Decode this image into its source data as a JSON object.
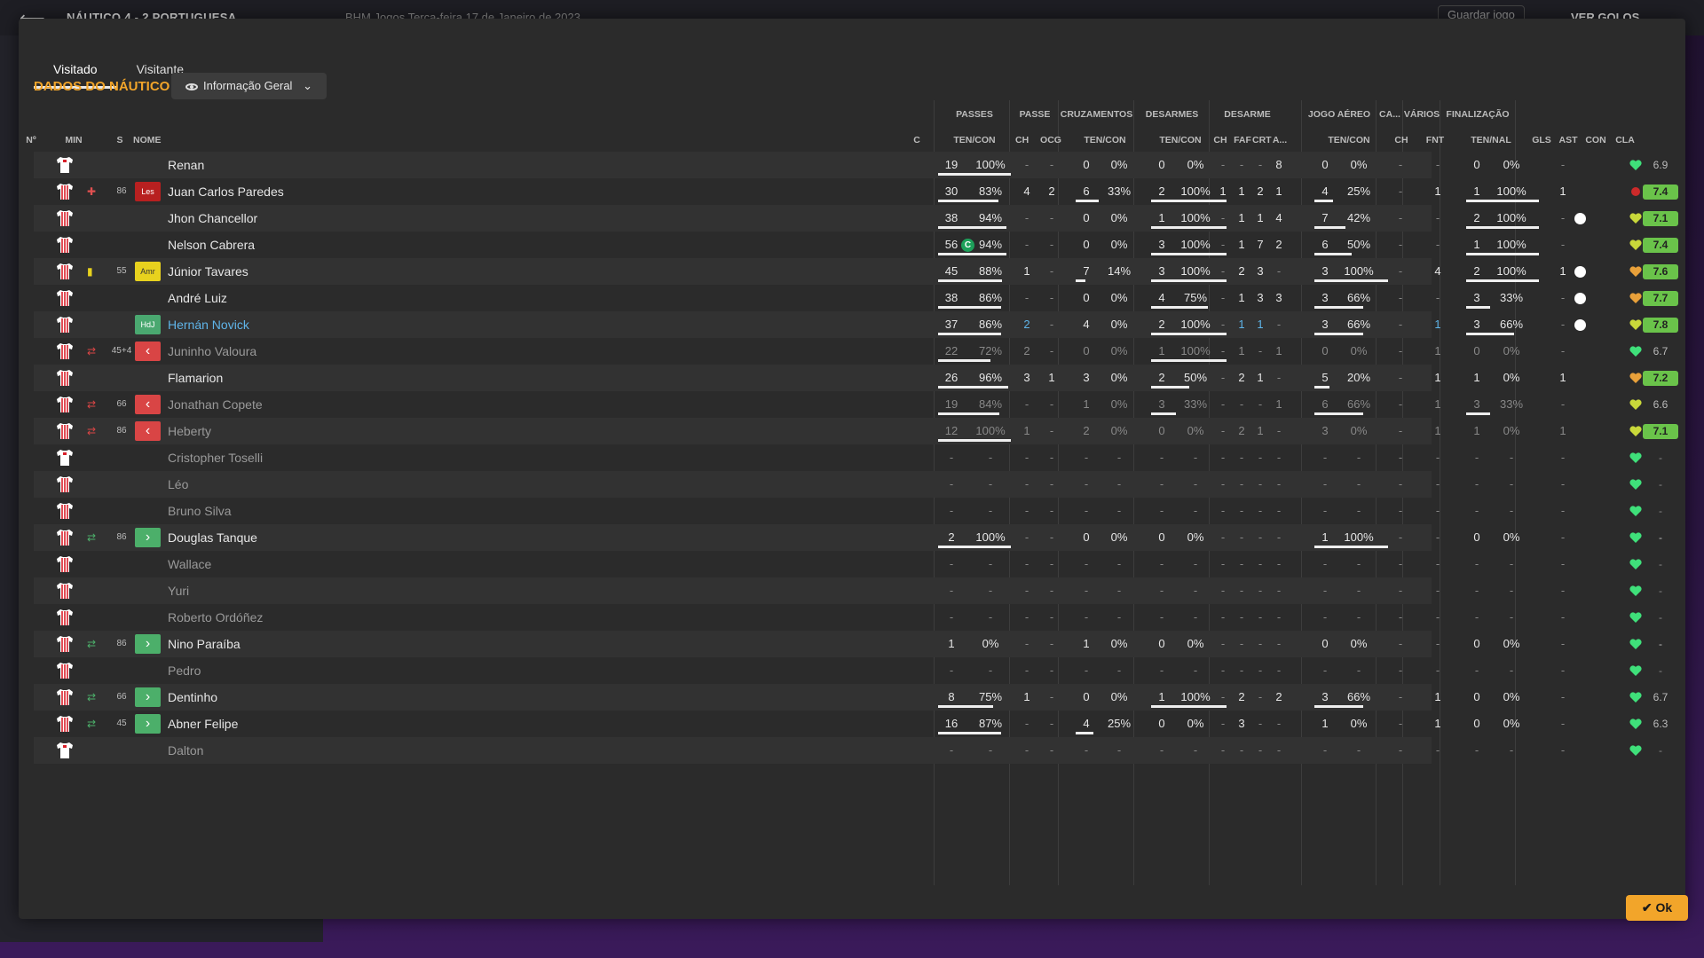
{
  "background": {
    "match": "NÁUTICO 4 - 2 PORTUGUESA",
    "venue_date": "BHM Jogos    Terça-feira 17 de Janeiro de 2023",
    "save_label": "Guardar jogo",
    "goals_label": "VER GOLOS"
  },
  "tabs": [
    {
      "label": "Visitado"
    },
    {
      "label": "Visitante"
    }
  ],
  "team_title": "DADOS DO NÁUTICO",
  "view_selector": "Informação Geral",
  "ok_label": "Ok",
  "headers": {
    "groups": {
      "passes": "PASSES",
      "passe": "PASSE",
      "cruzamentos": "CRUZAMENTOS",
      "desarmes": "DESARMES",
      "desarme": "DESARME",
      "jogo_aereo": "JOGO AÉREO",
      "ca": "CA...",
      "varios": "VÁRIOS",
      "finalizacao": "FINALIZAÇÃO"
    },
    "cols": {
      "num": "Nº",
      "min": "MIN",
      "s": "S",
      "nome": "NOME",
      "c": "C",
      "passes_tc": "TEN/CON",
      "passe_ch": "CH",
      "passe_ocg": "OCG",
      "cruz_tc": "TEN/CON",
      "des_tc": "TEN/CON",
      "d_ch": "CH",
      "d_faf": "FAF",
      "d_crt": "CRT",
      "d_a": "A...",
      "aer_tc": "TEN/CON",
      "ca_ch": "CH",
      "fnt": "FNT",
      "fin_tn": "TEN/NAL",
      "gls": "GLS",
      "ast": "AST",
      "con": "CON",
      "cla": "CLA"
    }
  },
  "colors": {
    "accent": "#f2a52a",
    "rating_green": "#6ac34a",
    "rating_dim": "#888",
    "red_card": "#cc2a2a",
    "yellow": "#e8d21e",
    "sub_out": "#d94545",
    "sub_in": "#4caf6a",
    "link": "#5fb4e8"
  },
  "players": [
    {
      "name": "Renan",
      "min": "",
      "badge": "",
      "sub": "",
      "p1": "19",
      "p2": "100%",
      "pb": 1.0,
      "pch": "-",
      "pocg": "-",
      "c1": "0",
      "c2": "0%",
      "cb": 0,
      "d1": "0",
      "d2": "0%",
      "db": 0,
      "dch": "-",
      "dfaf": "-",
      "dcrt": "-",
      "da": "8",
      "a1": "0",
      "a2": "0%",
      "ab": 0,
      "cach": "-",
      "fnt": "-",
      "f1": "0",
      "f2": "0%",
      "fb": 0,
      "gls": "",
      "ast": "-",
      "con": "green",
      "cla": "6.9",
      "claStyle": "plain",
      "dim": false,
      "gk": true
    },
    {
      "name": "Juan Carlos Paredes",
      "min": "86",
      "badge": "Les",
      "sub": "injury",
      "p1": "30",
      "p2": "83%",
      "pb": 0.83,
      "pch": "4",
      "pocg": "2",
      "c1": "6",
      "c2": "33%",
      "cb": 0.33,
      "d1": "2",
      "d2": "100%",
      "db": 1.0,
      "dch": "1",
      "dfaf": "1",
      "dcrt": "2",
      "da": "1",
      "a1": "4",
      "a2": "25%",
      "ab": 0.25,
      "cach": "-",
      "fnt": "1",
      "f1": "1",
      "f2": "100%",
      "fb": 1.0,
      "gls": "",
      "ast": "1",
      "con": "red",
      "cla": "7.4",
      "claStyle": "green",
      "dim": false
    },
    {
      "name": "Jhon Chancellor",
      "min": "",
      "badge": "",
      "sub": "",
      "p1": "38",
      "p2": "94%",
      "pb": 0.94,
      "pch": "-",
      "pocg": "-",
      "c1": "0",
      "c2": "0%",
      "cb": 0,
      "d1": "1",
      "d2": "100%",
      "db": 1.0,
      "dch": "-",
      "dfaf": "1",
      "dcrt": "1",
      "da": "4",
      "a1": "7",
      "a2": "42%",
      "ab": 0.42,
      "cach": "-",
      "fnt": "-",
      "f1": "2",
      "f2": "100%",
      "fb": 1.0,
      "gls": "ball",
      "ast": "-",
      "con": "yellow",
      "cla": "7.1",
      "claStyle": "green",
      "dim": false
    },
    {
      "name": "Nelson Cabrera",
      "min": "",
      "badge": "",
      "sub": "",
      "p1": "56",
      "p2": "94%",
      "pb": 0.94,
      "pch": "-",
      "pocg": "-",
      "c1": "0",
      "c2": "0%",
      "cb": 0,
      "d1": "3",
      "d2": "100%",
      "db": 1.0,
      "dch": "-",
      "dfaf": "1",
      "dcrt": "7",
      "da": "2",
      "a1": "6",
      "a2": "50%",
      "ab": 0.5,
      "cach": "-",
      "fnt": "-",
      "f1": "1",
      "f2": "100%",
      "fb": 1.0,
      "gls": "",
      "ast": "-",
      "con": "yellow",
      "cla": "7.4",
      "claStyle": "green",
      "dim": false,
      "captain": "C"
    },
    {
      "name": "Júnior Tavares",
      "min": "55",
      "badge": "Amr",
      "sub": "yellow",
      "p1": "45",
      "p2": "88%",
      "pb": 0.88,
      "pch": "1",
      "pocg": "-",
      "c1": "7",
      "c2": "14%",
      "cb": 0.14,
      "d1": "3",
      "d2": "100%",
      "db": 1.0,
      "dch": "-",
      "dfaf": "2",
      "dcrt": "3",
      "da": "-",
      "a1": "3",
      "a2": "100%",
      "ab": 1.0,
      "cach": "-",
      "fnt": "4",
      "f1": "2",
      "f2": "100%",
      "fb": 1.0,
      "gls": "ball",
      "ast": "1",
      "con": "orange",
      "cla": "7.6",
      "claStyle": "green",
      "dim": false
    },
    {
      "name": "André Luiz",
      "min": "",
      "badge": "",
      "sub": "",
      "p1": "38",
      "p2": "86%",
      "pb": 0.86,
      "pch": "-",
      "pocg": "-",
      "c1": "0",
      "c2": "0%",
      "cb": 0,
      "d1": "4",
      "d2": "75%",
      "db": 0.75,
      "dch": "-",
      "dfaf": "1",
      "dcrt": "3",
      "da": "3",
      "a1": "3",
      "a2": "66%",
      "ab": 0.66,
      "cach": "-",
      "fnt": "-",
      "f1": "3",
      "f2": "33%",
      "fb": 0.33,
      "gls": "ball",
      "ast": "-",
      "con": "orange",
      "cla": "7.7",
      "claStyle": "green",
      "dim": false
    },
    {
      "name": "Hernán Novick",
      "min": "",
      "badge": "HdJ",
      "sub": "",
      "p1": "37",
      "p2": "86%",
      "pb": 0.86,
      "pch": "2",
      "pocg": "-",
      "c1": "4",
      "c2": "0%",
      "cb": 0,
      "d1": "2",
      "d2": "100%",
      "db": 1.0,
      "dch": "-",
      "dfaf": "1",
      "dcrt": "1",
      "da": "-",
      "a1": "3",
      "a2": "66%",
      "ab": 0.66,
      "cach": "-",
      "fnt": "1",
      "f1": "3",
      "f2": "66%",
      "fb": 0.66,
      "gls": "ball",
      "ast": "-",
      "con": "yellow",
      "cla": "7.8",
      "claStyle": "green",
      "dim": false,
      "link": true
    },
    {
      "name": "Juninho Valoura",
      "min": "45+4",
      "badge": "",
      "sub": "out",
      "p1": "22",
      "p2": "72%",
      "pb": 0.72,
      "pch": "2",
      "pocg": "-",
      "c1": "0",
      "c2": "0%",
      "cb": 0,
      "d1": "1",
      "d2": "100%",
      "db": 1.0,
      "dch": "-",
      "dfaf": "1",
      "dcrt": "-",
      "da": "1",
      "a1": "0",
      "a2": "0%",
      "ab": 0,
      "cach": "-",
      "fnt": "1",
      "f1": "0",
      "f2": "0%",
      "fb": 0,
      "gls": "",
      "ast": "-",
      "con": "green",
      "cla": "6.7",
      "claStyle": "plain",
      "dim": true
    },
    {
      "name": "Flamarion",
      "min": "",
      "badge": "",
      "sub": "",
      "p1": "26",
      "p2": "96%",
      "pb": 0.96,
      "pch": "3",
      "pocg": "1",
      "c1": "3",
      "c2": "0%",
      "cb": 0,
      "d1": "2",
      "d2": "50%",
      "db": 0.5,
      "dch": "-",
      "dfaf": "2",
      "dcrt": "1",
      "da": "-",
      "a1": "5",
      "a2": "20%",
      "ab": 0.2,
      "cach": "-",
      "fnt": "1",
      "f1": "1",
      "f2": "0%",
      "fb": 0,
      "gls": "",
      "ast": "1",
      "con": "orange",
      "cla": "7.2",
      "claStyle": "green",
      "dim": false
    },
    {
      "name": "Jonathan Copete",
      "min": "66",
      "badge": "",
      "sub": "out",
      "p1": "19",
      "p2": "84%",
      "pb": 0.84,
      "pch": "-",
      "pocg": "-",
      "c1": "1",
      "c2": "0%",
      "cb": 0,
      "d1": "3",
      "d2": "33%",
      "db": 0.33,
      "dch": "-",
      "dfaf": "-",
      "dcrt": "-",
      "da": "1",
      "a1": "6",
      "a2": "66%",
      "ab": 0.66,
      "cach": "-",
      "fnt": "1",
      "f1": "3",
      "f2": "33%",
      "fb": 0.33,
      "gls": "",
      "ast": "-",
      "con": "yellow",
      "cla": "6.6",
      "claStyle": "plain",
      "dim": true
    },
    {
      "name": "Heberty",
      "min": "86",
      "badge": "",
      "sub": "out",
      "p1": "12",
      "p2": "100%",
      "pb": 1.0,
      "pch": "1",
      "pocg": "-",
      "c1": "2",
      "c2": "0%",
      "cb": 0,
      "d1": "0",
      "d2": "0%",
      "db": 0,
      "dch": "-",
      "dfaf": "2",
      "dcrt": "1",
      "da": "-",
      "a1": "3",
      "a2": "0%",
      "ab": 0,
      "cach": "-",
      "fnt": "1",
      "f1": "1",
      "f2": "0%",
      "fb": 0,
      "gls": "",
      "ast": "1",
      "con": "yellow",
      "cla": "7.1",
      "claStyle": "green",
      "dim": true
    },
    {
      "name": "Cristopher Toselli",
      "min": "",
      "badge": "",
      "sub": "",
      "empty": true,
      "con": "green",
      "dim": true,
      "gk": true
    },
    {
      "name": "Léo",
      "min": "",
      "badge": "",
      "sub": "",
      "empty": true,
      "con": "green",
      "dim": true
    },
    {
      "name": "Bruno Silva",
      "min": "",
      "badge": "",
      "sub": "",
      "empty": true,
      "con": "green",
      "dim": true
    },
    {
      "name": "Douglas Tanque",
      "min": "86",
      "badge": "",
      "sub": "in",
      "p1": "2",
      "p2": "100%",
      "pb": 1.0,
      "pch": "-",
      "pocg": "-",
      "c1": "0",
      "c2": "0%",
      "cb": 0,
      "d1": "0",
      "d2": "0%",
      "db": 0,
      "dch": "-",
      "dfaf": "-",
      "dcrt": "-",
      "da": "-",
      "a1": "1",
      "a2": "100%",
      "ab": 1.0,
      "cach": "-",
      "fnt": "-",
      "f1": "0",
      "f2": "0%",
      "fb": 0,
      "gls": "",
      "ast": "-",
      "con": "green",
      "cla": "-",
      "claStyle": "plain",
      "dim": false
    },
    {
      "name": "Wallace",
      "min": "",
      "badge": "",
      "sub": "",
      "empty": true,
      "con": "green",
      "dim": true
    },
    {
      "name": "Yuri",
      "min": "",
      "badge": "",
      "sub": "",
      "empty": true,
      "con": "green",
      "dim": true
    },
    {
      "name": "Roberto Ordóñez",
      "min": "",
      "badge": "",
      "sub": "",
      "empty": true,
      "con": "green",
      "dim": true
    },
    {
      "name": "Nino Paraíba",
      "min": "86",
      "badge": "",
      "sub": "in",
      "p1": "1",
      "p2": "0%",
      "pb": 0,
      "pch": "-",
      "pocg": "-",
      "c1": "1",
      "c2": "0%",
      "cb": 0,
      "d1": "0",
      "d2": "0%",
      "db": 0,
      "dch": "-",
      "dfaf": "-",
      "dcrt": "-",
      "da": "-",
      "a1": "0",
      "a2": "0%",
      "ab": 0,
      "cach": "-",
      "fnt": "-",
      "f1": "0",
      "f2": "0%",
      "fb": 0,
      "gls": "",
      "ast": "-",
      "con": "green",
      "cla": "-",
      "claStyle": "plain",
      "dim": false
    },
    {
      "name": "Pedro",
      "min": "",
      "badge": "",
      "sub": "",
      "empty": true,
      "con": "green",
      "dim": true
    },
    {
      "name": "Dentinho",
      "min": "66",
      "badge": "",
      "sub": "in",
      "p1": "8",
      "p2": "75%",
      "pb": 0.75,
      "pch": "1",
      "pocg": "-",
      "c1": "0",
      "c2": "0%",
      "cb": 0,
      "d1": "1",
      "d2": "100%",
      "db": 1.0,
      "dch": "-",
      "dfaf": "2",
      "dcrt": "-",
      "da": "2",
      "a1": "3",
      "a2": "66%",
      "ab": 0.66,
      "cach": "-",
      "fnt": "1",
      "f1": "0",
      "f2": "0%",
      "fb": 0,
      "gls": "",
      "ast": "-",
      "con": "green",
      "cla": "6.7",
      "claStyle": "plain",
      "dim": false
    },
    {
      "name": "Abner Felipe",
      "min": "45",
      "badge": "",
      "sub": "in",
      "p1": "16",
      "p2": "87%",
      "pb": 0.87,
      "pch": "-",
      "pocg": "-",
      "c1": "4",
      "c2": "25%",
      "cb": 0.25,
      "d1": "0",
      "d2": "0%",
      "db": 0,
      "dch": "-",
      "dfaf": "3",
      "dcrt": "-",
      "da": "-",
      "a1": "1",
      "a2": "0%",
      "ab": 0,
      "cach": "-",
      "fnt": "1",
      "f1": "0",
      "f2": "0%",
      "fb": 0,
      "gls": "",
      "ast": "-",
      "con": "green",
      "cla": "6.3",
      "claStyle": "plain",
      "dim": false
    },
    {
      "name": "Dalton",
      "min": "",
      "badge": "",
      "sub": "",
      "empty": true,
      "con": "green",
      "dim": true,
      "gk": true
    }
  ]
}
